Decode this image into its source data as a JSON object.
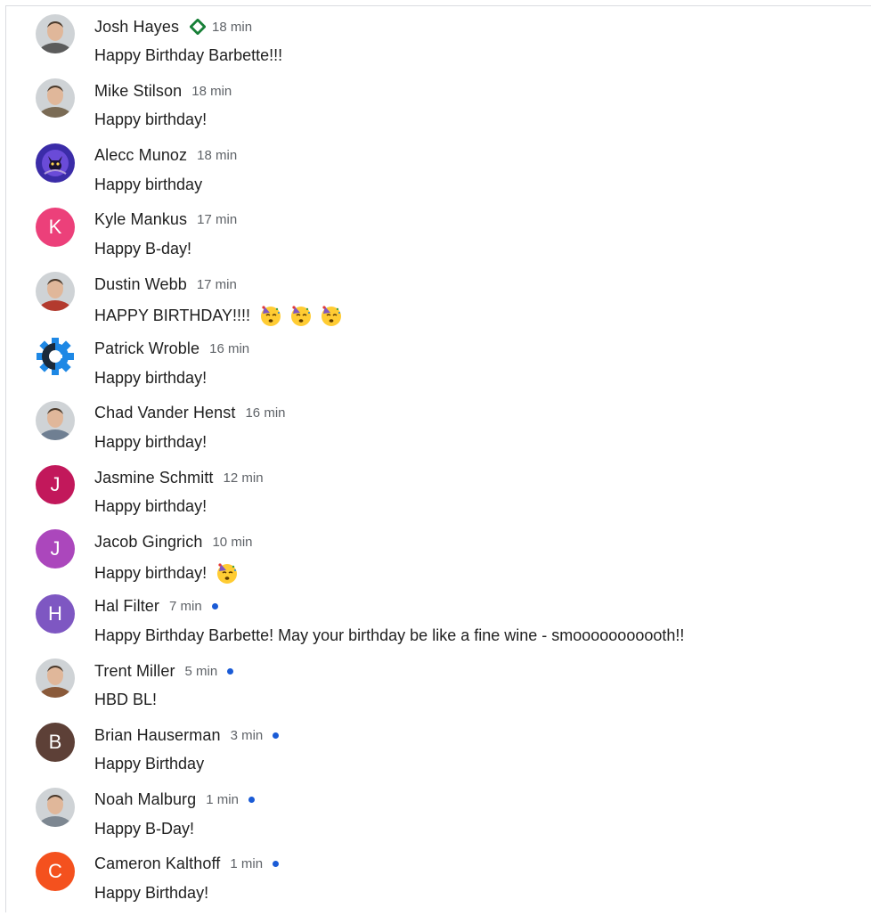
{
  "messages": [
    {
      "name": "Josh Hayes",
      "time": "18 min",
      "text": "Happy Birthday Barbette!!!",
      "avatar": "photo",
      "avatar_color": "#5b5b5b",
      "verified_badge": true,
      "unread": false,
      "emojis": 0
    },
    {
      "name": "Mike Stilson",
      "time": "18 min",
      "text": "Happy birthday!",
      "avatar": "photo",
      "avatar_color": "#7a6b55",
      "verified_badge": false,
      "unread": false,
      "emojis": 0
    },
    {
      "name": "Alecc Munoz",
      "time": "18 min",
      "text": "Happy birthday",
      "avatar": "cat-art",
      "avatar_color": "#3b2ca8",
      "verified_badge": false,
      "unread": false,
      "emojis": 0
    },
    {
      "name": "Kyle Mankus",
      "time": "17 min",
      "text": "Happy B-day!",
      "avatar": "letter",
      "initial": "K",
      "avatar_color": "#ec407a",
      "verified_badge": false,
      "unread": false,
      "emojis": 0
    },
    {
      "name": "Dustin Webb",
      "time": "17 min",
      "text": "HAPPY BIRTHDAY!!!!",
      "avatar": "photo",
      "avatar_color": "#b33a2e",
      "verified_badge": false,
      "unread": false,
      "emojis": 3
    },
    {
      "name": "Patrick Wroble",
      "time": "16 min",
      "text": "Happy birthday!",
      "avatar": "gear-logo",
      "avatar_color": "#1e88e5",
      "verified_badge": false,
      "unread": false,
      "emojis": 0
    },
    {
      "name": "Chad Vander Henst",
      "time": "16 min",
      "text": "Happy birthday!",
      "avatar": "photo",
      "avatar_color": "#6f7f92",
      "verified_badge": false,
      "unread": false,
      "emojis": 0
    },
    {
      "name": "Jasmine Schmitt",
      "time": "12 min",
      "text": "Happy birthday!",
      "avatar": "letter",
      "initial": "J",
      "avatar_color": "#c2185b",
      "verified_badge": false,
      "unread": false,
      "emojis": 0
    },
    {
      "name": "Jacob Gingrich",
      "time": "10 min",
      "text": "Happy birthday!",
      "avatar": "letter",
      "initial": "J",
      "avatar_color": "#ab47bc",
      "verified_badge": false,
      "unread": false,
      "emojis": 1
    },
    {
      "name": "Hal Filter",
      "time": "7 min",
      "text": "Happy Birthday Barbette! May your birthday be like a fine wine - smooooooooooth!!",
      "avatar": "letter",
      "initial": "H",
      "avatar_color": "#7e57c2",
      "verified_badge": false,
      "unread": true,
      "emojis": 0
    },
    {
      "name": "Trent Miller",
      "time": "5 min",
      "text": "HBD BL!",
      "avatar": "photo",
      "avatar_color": "#8a5a3a",
      "verified_badge": false,
      "unread": true,
      "emojis": 0
    },
    {
      "name": "Brian Hauserman",
      "time": "3 min",
      "text": "Happy Birthday",
      "avatar": "letter",
      "initial": "B",
      "avatar_color": "#5d4037",
      "verified_badge": false,
      "unread": true,
      "emojis": 0
    },
    {
      "name": "Noah Malburg",
      "time": "1 min",
      "text": "Happy B-Day!",
      "avatar": "photo",
      "avatar_color": "#7d8791",
      "verified_badge": false,
      "unread": true,
      "emojis": 0
    },
    {
      "name": "Cameron Kalthoff",
      "time": "1 min",
      "text": "Happy Birthday!",
      "avatar": "letter",
      "initial": "C",
      "avatar_color": "#f4511e",
      "verified_badge": false,
      "unread": true,
      "emojis": 0
    }
  ],
  "colors": {
    "badge_green": "#188038",
    "unread_dot": "#1a5bd6",
    "name_text": "#1f1f1f",
    "time_text": "#5f6368"
  },
  "icons": {
    "verified": "diamond-icon",
    "emoji": "partying-face-emoji"
  }
}
